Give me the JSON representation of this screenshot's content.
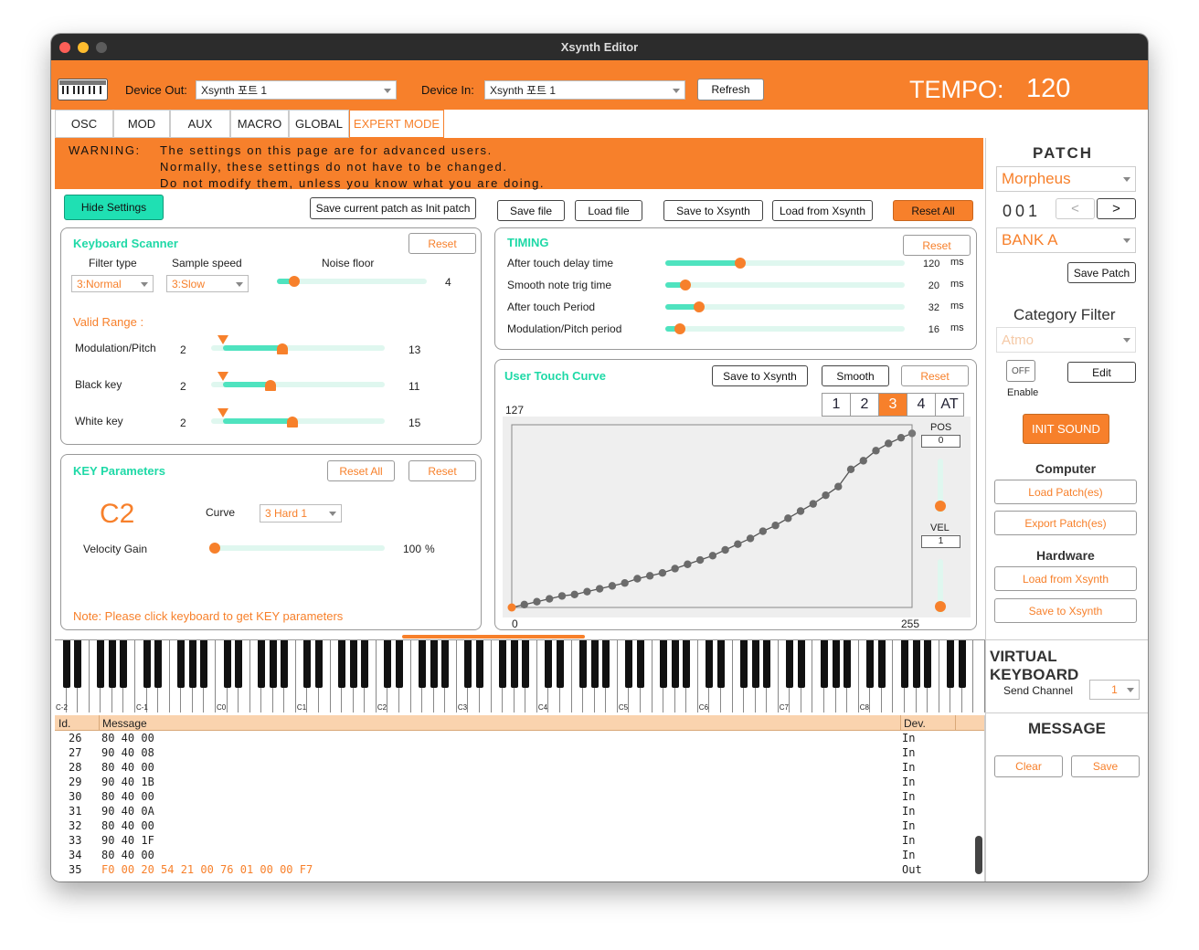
{
  "window": {
    "title": "Xsynth Editor"
  },
  "topbar": {
    "device_out_label": "Device Out:",
    "device_out_value": "Xsynth 포트 1",
    "device_in_label": "Device In:",
    "device_in_value": "Xsynth 포트 1",
    "refresh_label": "Refresh",
    "tempo_label": "TEMPO:",
    "tempo_value": "120"
  },
  "tabs": [
    {
      "label": "OSC"
    },
    {
      "label": "MOD"
    },
    {
      "label": "AUX"
    },
    {
      "label": "MACRO"
    },
    {
      "label": "GLOBAL"
    },
    {
      "label": "EXPERT MODE",
      "active": true
    }
  ],
  "warning": {
    "title": "WARNING:",
    "line1": "The settings on this page are for advanced users.",
    "line2": "Normally, these settings do not have to be changed.",
    "line3": "Do not modify them, unless you know what you are doing."
  },
  "toolbar": {
    "hide_settings": "Hide Settings",
    "save_init": "Save current patch as Init patch",
    "save_file": "Save file",
    "load_file": "Load file",
    "save_xsynth": "Save to Xsynth",
    "load_xsynth": "Load from Xsynth",
    "reset_all": "Reset All"
  },
  "scanner": {
    "title": "Keyboard Scanner",
    "reset": "Reset",
    "filter_type_label": "Filter type",
    "filter_type_value": "3:Normal",
    "sample_speed_label": "Sample speed",
    "sample_speed_value": "3:Slow",
    "noise_floor_label": "Noise floor",
    "noise_floor_value": "4",
    "noise_floor_fraction": 0.08,
    "valid_range_title": "Valid Range :",
    "ranges": [
      {
        "label": "Modulation/Pitch",
        "min": "2",
        "max": "13",
        "lo": 0.07,
        "hi": 0.41
      },
      {
        "label": "Black key",
        "min": "2",
        "max": "11",
        "lo": 0.07,
        "hi": 0.34
      },
      {
        "label": "White key",
        "min": "2",
        "max": "15",
        "lo": 0.07,
        "hi": 0.47
      }
    ]
  },
  "timing": {
    "title": "TIMING",
    "reset": "Reset",
    "unit": "ms",
    "rows": [
      {
        "label": "After touch delay time",
        "value": "120",
        "fraction": 0.29
      },
      {
        "label": "Smooth note trig time",
        "value": "20",
        "fraction": 0.06
      },
      {
        "label": "After touch Period",
        "value": "32",
        "fraction": 0.12
      },
      {
        "label": "Modulation/Pitch period",
        "value": "16",
        "fraction": 0.04
      }
    ]
  },
  "key_params": {
    "title": "KEY Parameters",
    "reset_all": "Reset All",
    "reset": "Reset",
    "note": "C2",
    "curve_label": "Curve",
    "curve_value": "3 Hard 1",
    "velocity_gain_label": "Velocity Gain",
    "velocity_gain_value": "100",
    "velocity_gain_unit": "%",
    "velocity_gain_fraction": 0.0,
    "hint": "Note: Please click keyboard to get KEY parameters"
  },
  "curve": {
    "title": "User Touch Curve",
    "save_xsynth": "Save to Xsynth",
    "smooth": "Smooth",
    "reset": "Reset",
    "tabs": [
      "1",
      "2",
      "3",
      "4",
      "AT"
    ],
    "active_tab": "3",
    "y_max_label": "127",
    "x_min_label": "0",
    "x_max_label": "255",
    "pos_label": "POS",
    "pos_value": "0",
    "vel_label": "VEL",
    "vel_value": "1",
    "points": [
      [
        0,
        0
      ],
      [
        8,
        2
      ],
      [
        16,
        4
      ],
      [
        24,
        6
      ],
      [
        32,
        8
      ],
      [
        40,
        9
      ],
      [
        48,
        11
      ],
      [
        56,
        13
      ],
      [
        64,
        15
      ],
      [
        72,
        17
      ],
      [
        80,
        20
      ],
      [
        88,
        22
      ],
      [
        96,
        24
      ],
      [
        104,
        27
      ],
      [
        112,
        30
      ],
      [
        120,
        33
      ],
      [
        128,
        36
      ],
      [
        136,
        40
      ],
      [
        144,
        44
      ],
      [
        152,
        48
      ],
      [
        160,
        53
      ],
      [
        168,
        57
      ],
      [
        176,
        62
      ],
      [
        184,
        67
      ],
      [
        192,
        72
      ],
      [
        200,
        78
      ],
      [
        208,
        84
      ],
      [
        216,
        96
      ],
      [
        224,
        102
      ],
      [
        232,
        109
      ],
      [
        240,
        114
      ],
      [
        248,
        118
      ],
      [
        255,
        121
      ]
    ]
  },
  "patch": {
    "title": "PATCH",
    "name": "Morpheus",
    "number": "001",
    "prev": "<",
    "next": ">",
    "bank": "BANK A",
    "save_patch": "Save Patch",
    "category_title": "Category Filter",
    "category_value": "Atmo",
    "toggle_label": "OFF",
    "enable_label": "Enable",
    "edit_label": "Edit",
    "init_sound": "INIT  SOUND",
    "computer_title": "Computer",
    "load_patches": "Load Patch(es)",
    "export_patches": "Export Patch(es)",
    "hardware_title": "Hardware",
    "load_from_xsynth": "Load from Xsynth",
    "save_to_xsynth": "Save to Xsynth"
  },
  "virtual_keyboard": {
    "title": "VIRTUAL KEYBOARD",
    "send_channel_label": "Send Channel",
    "send_channel_value": "1",
    "octave_labels": [
      "C-2",
      "C-1",
      "C0",
      "C1",
      "C2",
      "C3",
      "C4",
      "C5",
      "C6",
      "C7",
      "C8"
    ]
  },
  "message": {
    "title": "MESSAGE",
    "clear": "Clear",
    "save": "Save",
    "col_id": "Id.",
    "col_message": "Message",
    "col_dev": "Dev.",
    "rows": [
      {
        "id": "26",
        "msg": "80 40 00",
        "dev": "In"
      },
      {
        "id": "27",
        "msg": "90 40 08",
        "dev": "In"
      },
      {
        "id": "28",
        "msg": "80 40 00",
        "dev": "In"
      },
      {
        "id": "29",
        "msg": "90 40 1B",
        "dev": "In"
      },
      {
        "id": "30",
        "msg": "80 40 00",
        "dev": "In"
      },
      {
        "id": "31",
        "msg": "90 40 0A",
        "dev": "In"
      },
      {
        "id": "32",
        "msg": "80 40 00",
        "dev": "In"
      },
      {
        "id": "33",
        "msg": "90 40 1F",
        "dev": "In"
      },
      {
        "id": "34",
        "msg": "80 40 00",
        "dev": "In"
      },
      {
        "id": "35",
        "msg": "F0 00 20 54 21 00 76 01 00 00 F7",
        "dev": "Out",
        "highlight": true
      }
    ]
  },
  "colors": {
    "accent": "#f7802b",
    "teal": "#1fd9a7",
    "track": "#4fe3bf"
  }
}
